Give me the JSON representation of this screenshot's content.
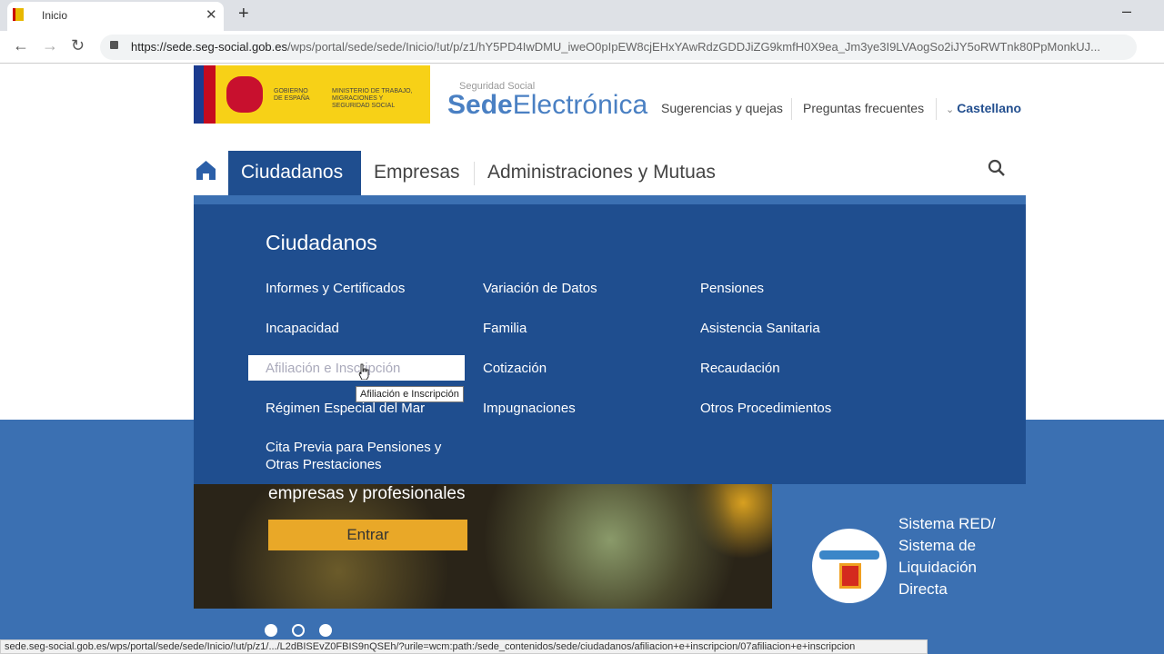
{
  "browser": {
    "tab_title": "Inicio",
    "url_host": "https://sede.seg-social.gob.es",
    "url_path": "/wps/portal/sede/sede/Inicio/!ut/p/z1/hY5PD4IwDMU_iweO0pIpEW8cjEHxYAwRdzGDDJiZG9kmfH0X9ea_Jm3ye3I9LVAogSo2iJY5oRWTnk80PpMonkUJ...",
    "status_url": "sede.seg-social.gob.es/wps/portal/sede/sede/Inicio/!ut/p/z1/.../L2dBISEvZ0FBIS9nQSEh/?urile=wcm:path:/sede_contenidos/sede/ciudadanos/afiliacion+e+inscripcion/07afiliacion+e+inscripcion"
  },
  "header": {
    "gov_line1": "GOBIERNO DE ESPAÑA",
    "ministry": "MINISTERIO DE TRABAJO, MIGRACIONES Y SEGURIDAD SOCIAL",
    "brand_sub": "Seguridad Social",
    "brand_bold": "Sede",
    "brand_light": "Electrónica",
    "links": [
      "Sugerencias y quejas",
      "Preguntas frecuentes"
    ],
    "language": "Castellano"
  },
  "nav": {
    "tabs": [
      "Ciudadanos",
      "Empresas",
      "Administraciones y Mutuas"
    ],
    "active": "Ciudadanos"
  },
  "menu": {
    "title": "Ciudadanos",
    "columns": [
      [
        "Informes y Certificados",
        "Incapacidad",
        "Afiliación e Inscripción",
        "Régimen Especial del Mar",
        "Cita Previa para Pensiones y Otras Prestaciones"
      ],
      [
        "Variación de Datos",
        "Familia",
        "Cotización",
        "Impugnaciones"
      ],
      [
        "Pensiones",
        "Asistencia Sanitaria",
        "Recaudación",
        "Otros Procedimientos"
      ]
    ],
    "hovered": "Afiliación e Inscripción",
    "tooltip": "Afiliación e Inscripción"
  },
  "banner": {
    "text": "empresas y profesionales",
    "button": "Entrar",
    "slides": 3,
    "active_slide": 2
  },
  "red": {
    "text": "Sistema RED/ Sistema de Liquidación Directa"
  },
  "colors": {
    "primary": "#1f4e8f",
    "band": "#3b70b2",
    "button": "#e9a828"
  }
}
